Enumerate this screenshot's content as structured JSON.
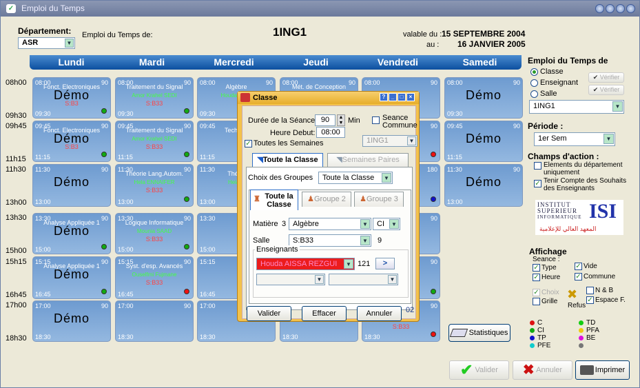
{
  "window": {
    "title": "Emploi du Temps"
  },
  "top": {
    "dept_label": "Département:",
    "dept_value": "ASR",
    "edt_de": "Emploi du Temps de:",
    "group_title": "1ING1",
    "valable_du_label": "valable du :",
    "valable_du": "15 SEPTEMBRE 2004",
    "au_label": "au :",
    "au": "16 JANVIER 2005"
  },
  "days": [
    "Lundi",
    "Mardi",
    "Mercredi",
    "Jeudi",
    "Vendredi",
    "Samedi"
  ],
  "times": [
    "08h00",
    "09h30",
    "09h45",
    "11h15",
    "11h30",
    "13h00",
    "13h30",
    "15h00",
    "15h15",
    "16h45",
    "17h00",
    "18h30"
  ],
  "cells": {
    "r0": [
      {
        "st": "08:00",
        "dur": "90",
        "nm": "Fonct. Electroniques",
        "demo": "Démo",
        "rm": "S:B3",
        "dot": "#1a1",
        "en": "09:30"
      },
      {
        "st": "08:00",
        "dur": "90",
        "nm": "Traitement du Signal",
        "pr": "Amor Krahel SEDI",
        "rm": "S:B33",
        "dot": "#1a1",
        "en": "09:30"
      },
      {
        "st": "08:00",
        "dur": "90",
        "nm": "Algèbre",
        "pr": "Houda Aissa",
        "en": "09:30"
      },
      {
        "st": "08:00",
        "dur": "90",
        "nm": "Mét. de Conception",
        "en": "09:30"
      },
      {
        "st": "08:00",
        "dur": "90",
        "nm": "",
        "en": "09:30"
      },
      {
        "st": "08:00",
        "dur": "90",
        "demo": "Démo",
        "en": "09:30"
      }
    ],
    "r1": [
      {
        "st": "09:45",
        "dur": "90",
        "nm": "Fonct. Electroniques",
        "demo": "Démo",
        "rm": "S:B3",
        "dot": "#1a1",
        "en": "11:15"
      },
      {
        "st": "09:45",
        "dur": "90",
        "nm": "Traitement du Signal",
        "pr": "Amor Krahel SEDI",
        "rm": "S:B33",
        "dot": "#1a1",
        "en": "11:15"
      },
      {
        "st": "09:45",
        "dur": "90",
        "nm": "Tech. de",
        "en": "11:15"
      },
      {
        "st": "09:45",
        "dur": "90",
        "en": "11:15"
      },
      {
        "st": "09:45",
        "dur": "90",
        "nm": "ées",
        "dot": "#e11",
        "en": "11:15"
      },
      {
        "st": "09:45",
        "dur": "90",
        "demo": "Démo",
        "en": "11:15"
      }
    ],
    "r2": [
      {
        "st": "11:30",
        "dur": "90",
        "demo": "Démo",
        "en": "13:00"
      },
      {
        "st": "11:30",
        "dur": "90",
        "nm": "Théorie Lang.Autom.",
        "pr": "Hela ENNAIFER",
        "rm": "S:B33",
        "dot": "#1a1",
        "en": "13:00"
      },
      {
        "st": "11:30",
        "dur": "90",
        "nm": "Théori",
        "pr": "Hela E",
        "en": "13:00"
      },
      {
        "st": "11:30",
        "dur": "90",
        "en": "13:00"
      },
      {
        "st": "11:30",
        "dur": "180",
        "nm": "xp.",
        "dot": "#11c",
        "en": "13:00"
      },
      {
        "st": "11:30",
        "dur": "90",
        "demo": "Démo",
        "en": "13:00"
      }
    ],
    "r3": [
      {
        "st": "13:30",
        "dur": "90",
        "nm": "Analyse Appliquée 1",
        "demo": "Démo",
        "dot": "#1a1",
        "en": "15:00"
      },
      {
        "st": "13:30",
        "dur": "90",
        "nm": "Logique Informatique",
        "pr": "Mounia SAAD",
        "rm": "S:B33",
        "dot": "#1a1",
        "en": "15:00"
      },
      {
        "st": "13:30",
        "dur": "90",
        "en": "15:00"
      },
      {
        "st": "13:30",
        "dur": "90",
        "en": "15:00"
      },
      {
        "st": "13:30",
        "dur": "90",
        "en": "15:00"
      },
      null
    ],
    "r4": [
      {
        "st": "15:15",
        "dur": "90",
        "nm": "Analyse Appliquée 1",
        "demo": "Démo",
        "dot": "#1a1",
        "en": "16:45"
      },
      {
        "st": "15:15",
        "dur": "90",
        "nm": "Syst. d'esp. Avancés",
        "pr": "Ouselfmi Fujmane",
        "rm": "S:B33",
        "dot": "#e11",
        "en": "16:45"
      },
      {
        "st": "15:15",
        "dur": "90",
        "en": "16:45"
      },
      {
        "st": "15:15",
        "dur": "90",
        "en": "16:45"
      },
      {
        "st": "15:15",
        "dur": "90",
        "nm": "ale",
        "dot": "#1a1",
        "en": "16:45"
      },
      null
    ],
    "r5": [
      {
        "st": "17:00",
        "dur": "90",
        "demo": "Démo",
        "en": "18:30"
      },
      {
        "st": "17:00",
        "dur": "90",
        "en": "18:30"
      },
      {
        "st": "17:00",
        "dur": "90",
        "en": "18:30"
      },
      {
        "st": "17:00",
        "dur": "90",
        "en": "18:30"
      },
      {
        "st": "17:00",
        "dur": "90",
        "nm": "ale",
        "pr": "ale",
        "rm": "S:B33",
        "dot": "#e11",
        "en": "18:30"
      },
      null
    ]
  },
  "right": {
    "edt_de_title": "Emploi du Temps de",
    "classe": "Classe",
    "enseignant": "Enseignant",
    "salle": "Salle",
    "verifier": "Vérifier",
    "selected": "1ING1",
    "periode_title": "Période :",
    "periode": "1er Sem",
    "champs_title": "Champs d'action :",
    "champ1": "Elements du département uniquement",
    "champ2": "Tenir Compte des Souhaits des Enseignants",
    "logo_line1": "INSTITUT",
    "logo_line2": "SUPERIEUR",
    "logo_line3": "INFORMATIQUE",
    "logo_isi": "ISI",
    "logo_ar": "المعهد العالي للإعلامية",
    "affichage_title": "Affichage",
    "seance": "Seance :",
    "type": "Type",
    "vide": "Vide",
    "heure": "Heure",
    "commune": "Commune",
    "choix": "Choix",
    "nb": "N & B",
    "grille": "Grille",
    "refus": "Refus",
    "espace": "Espace F.",
    "legend": [
      {
        "label": "C",
        "color": "#d11"
      },
      {
        "label": "TD",
        "color": "#1c1"
      },
      {
        "label": "CI",
        "color": "#1a1"
      },
      {
        "label": "PFA",
        "color": "#ec1"
      },
      {
        "label": "TP",
        "color": "#11c"
      },
      {
        "label": "BE",
        "color": "#d1d"
      },
      {
        "label": "PFE",
        "color": "#1cc"
      },
      {
        "label": "",
        "color": "#777"
      }
    ]
  },
  "buttons": {
    "statistiques": "Statistiques",
    "valider": "Valider",
    "annuler": "Annuler",
    "imprimer": "Imprimer"
  },
  "dialog": {
    "title": "Classe",
    "duree_label": "Durée de la Séance:",
    "duree": "90",
    "min": "Min",
    "seance_commune": "Seance Commune",
    "heure_debut_label": "Heure Debut:",
    "heure_debut": "08:00",
    "toutes_semaines": "Toutes les Semaines",
    "classe_combo": "1ING1",
    "tab_toute_classe": "Toute la Classe",
    "tab_semaines_paires": "Semaines Paires",
    "choix_groupes_label": "Choix des Groupes",
    "choix_groupes": "Toute la Classe",
    "sub_tab1": "Toute la Classe",
    "sub_tab2": "Groupe 2",
    "sub_tab3": "Groupe 3",
    "matiere_label": "Matière",
    "matiere_num": "3",
    "matiere": "Algèbre",
    "matiere_type": "CI",
    "salle_label": "Salle",
    "salle": "S:B33",
    "salle_num": "9",
    "enseignants_label": "Enseignants",
    "enseignant": "Houda AISSA REZGUI",
    "ens_num": "121",
    "valider": "Valider",
    "effacer": "Effacer",
    "annuler": "Annuler",
    "count": "02"
  }
}
